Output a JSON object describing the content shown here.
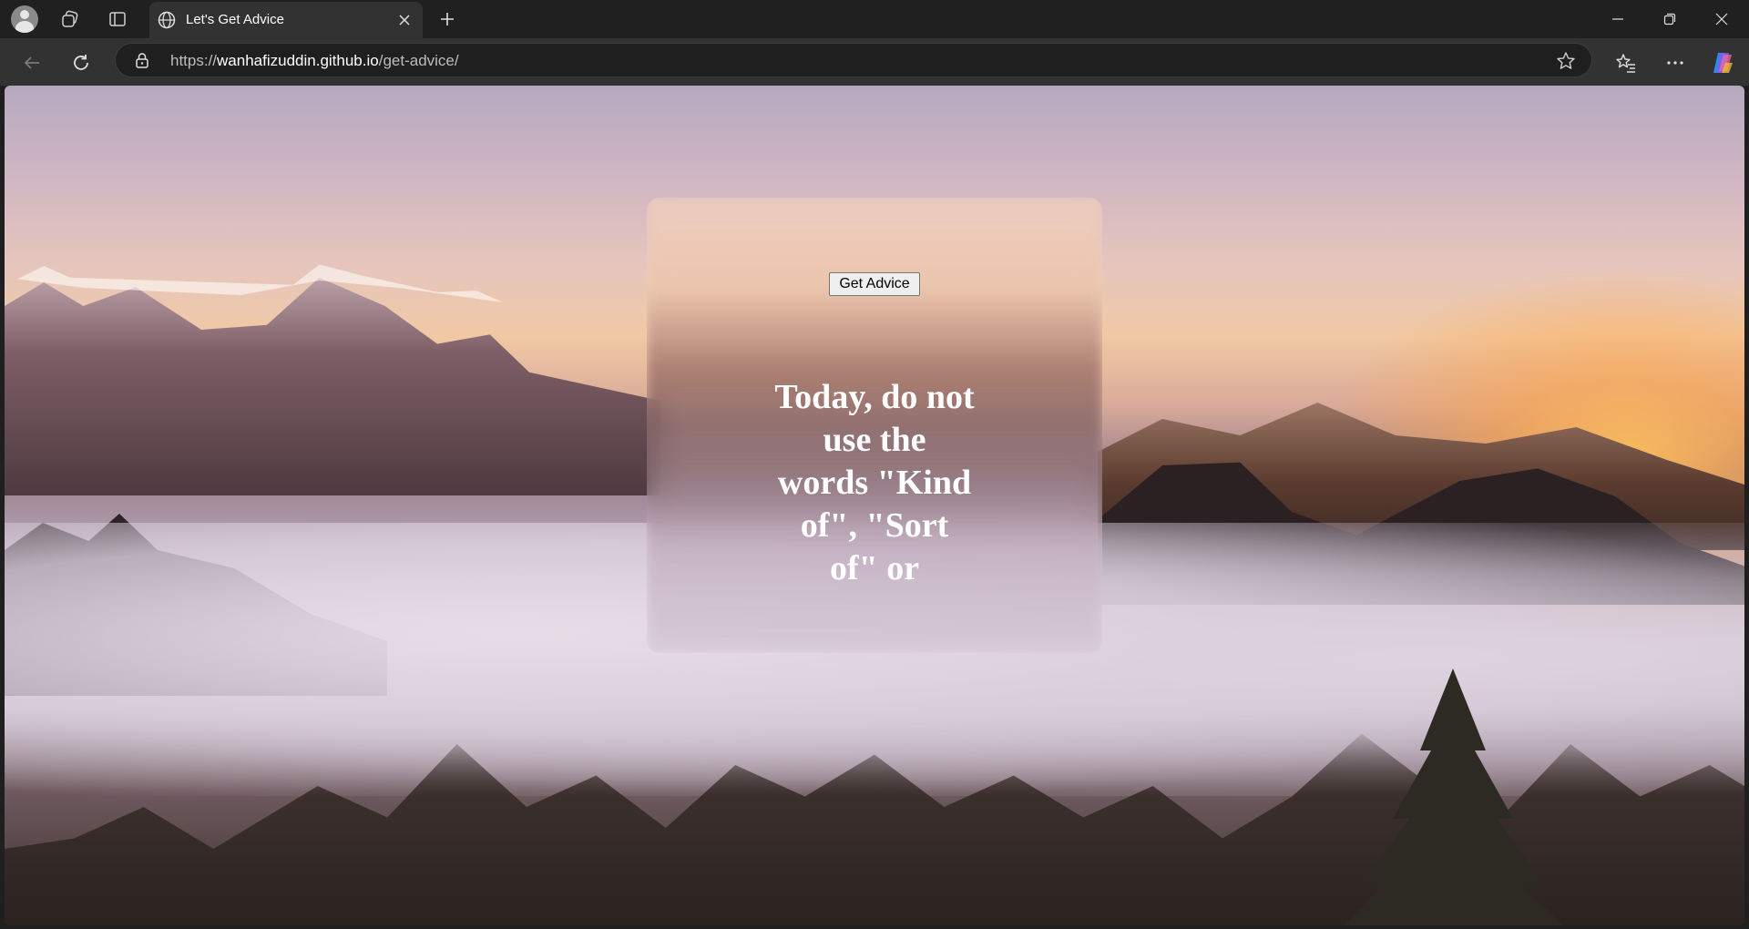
{
  "browser": {
    "tab": {
      "title": "Let's Get Advice"
    },
    "address": {
      "scheme": "https://",
      "host": "wanhafizuddin.github.io",
      "path": "/get-advice/"
    }
  },
  "page": {
    "button_label": "Get Advice",
    "advice_text": "Today, do not use the words \"Kind of\", \"Sort of\" or \"Maybe\". It"
  },
  "icons": {
    "profile": "avatar-icon",
    "workspaces": "workspaces-icon",
    "tab_actions": "tab-actions-icon",
    "favicon": "globe-icon",
    "close_tab": "close-icon",
    "new_tab": "plus-icon",
    "back": "back-arrow-icon",
    "reload": "reload-icon",
    "lock": "lock-icon",
    "favorite": "star-icon",
    "favorites": "favorites-icon",
    "more": "more-icon",
    "copilot": "copilot-icon"
  }
}
